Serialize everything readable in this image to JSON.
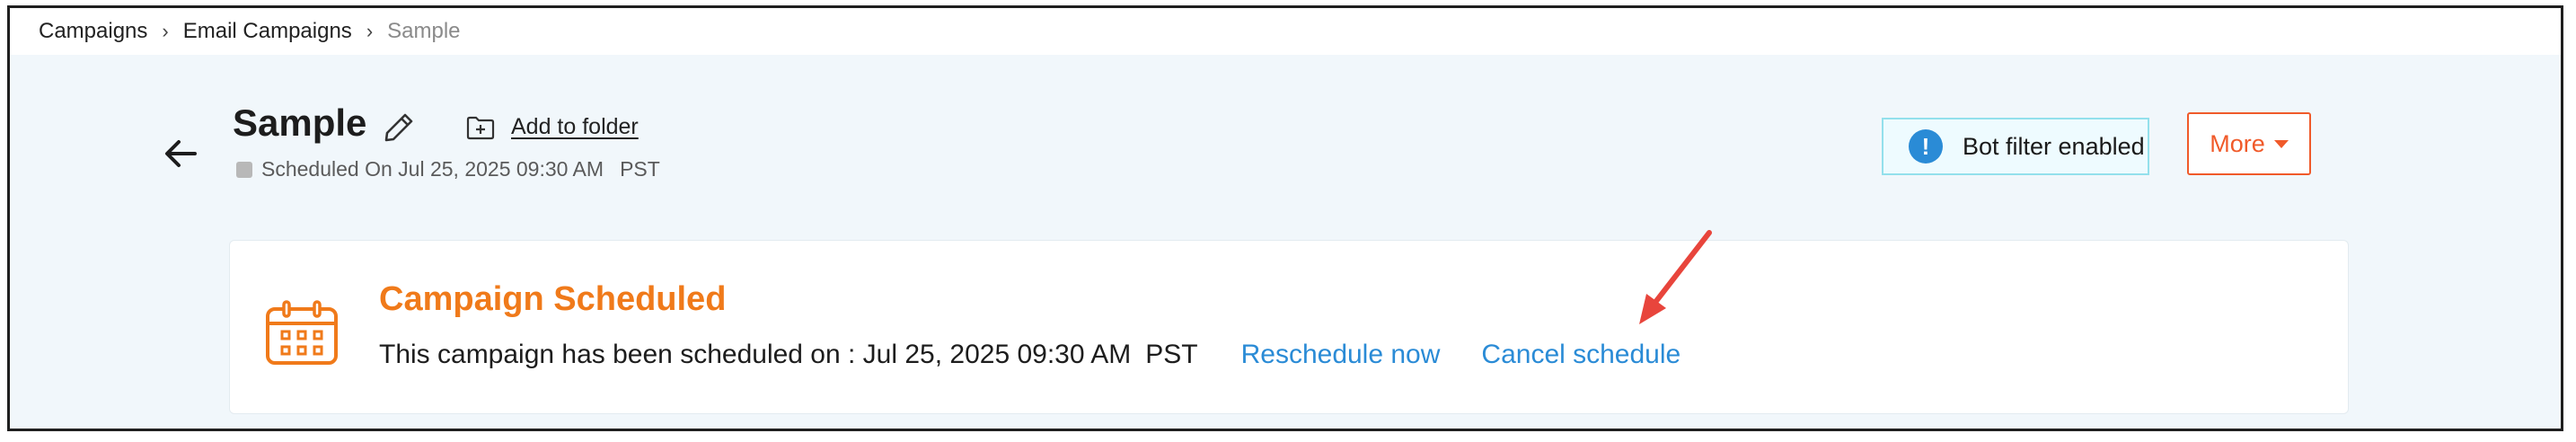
{
  "breadcrumb": {
    "items": [
      "Campaigns",
      "Email Campaigns"
    ],
    "current": "Sample"
  },
  "header": {
    "title": "Sample",
    "add_to_folder": "Add to folder",
    "status_text": "Scheduled On Jul 25, 2025 09:30 AM",
    "status_tz": "PST",
    "bot_filter": "Bot filter enabled",
    "more_label": "More"
  },
  "card": {
    "title": "Campaign Scheduled",
    "message": "This campaign has been scheduled on : Jul 25, 2025 09:30 AM",
    "tz": "PST",
    "reschedule_label": "Reschedule now",
    "cancel_label": "Cancel schedule"
  },
  "colors": {
    "accent_orange": "#f07a1a",
    "link_blue": "#2a8bd6",
    "more_red": "#f05a2a",
    "annotation_arrow": "#e8453c"
  },
  "icons": {
    "back": "back-arrow-icon",
    "edit": "pencil-icon",
    "folder": "folder-plus-icon",
    "info": "info-icon",
    "calendar": "calendar-icon"
  }
}
